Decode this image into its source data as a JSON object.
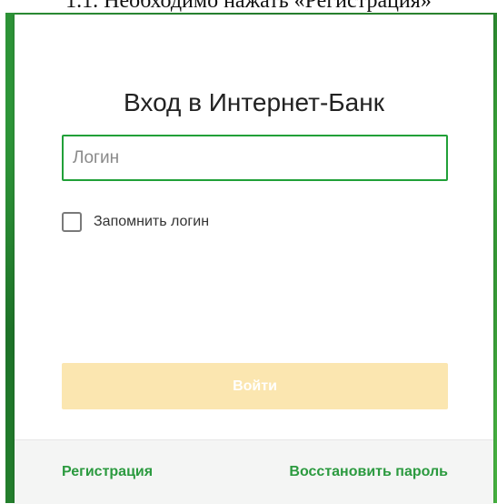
{
  "document": {
    "heading": "1.1. Необходимо нажать «Регистрация»"
  },
  "login_form": {
    "title": "Вход в Интернет-Банк",
    "login_input": {
      "placeholder": "Логин",
      "value": ""
    },
    "remember": {
      "label": "Запомнить логин",
      "checked": false
    },
    "submit_label": "Войти",
    "footer": {
      "register_label": "Регистрация",
      "restore_label": "Восстановить пароль"
    }
  },
  "colors": {
    "accent_green": "#21a038",
    "link_green": "#2b9a3f",
    "button_disabled": "#fbe6b0"
  }
}
